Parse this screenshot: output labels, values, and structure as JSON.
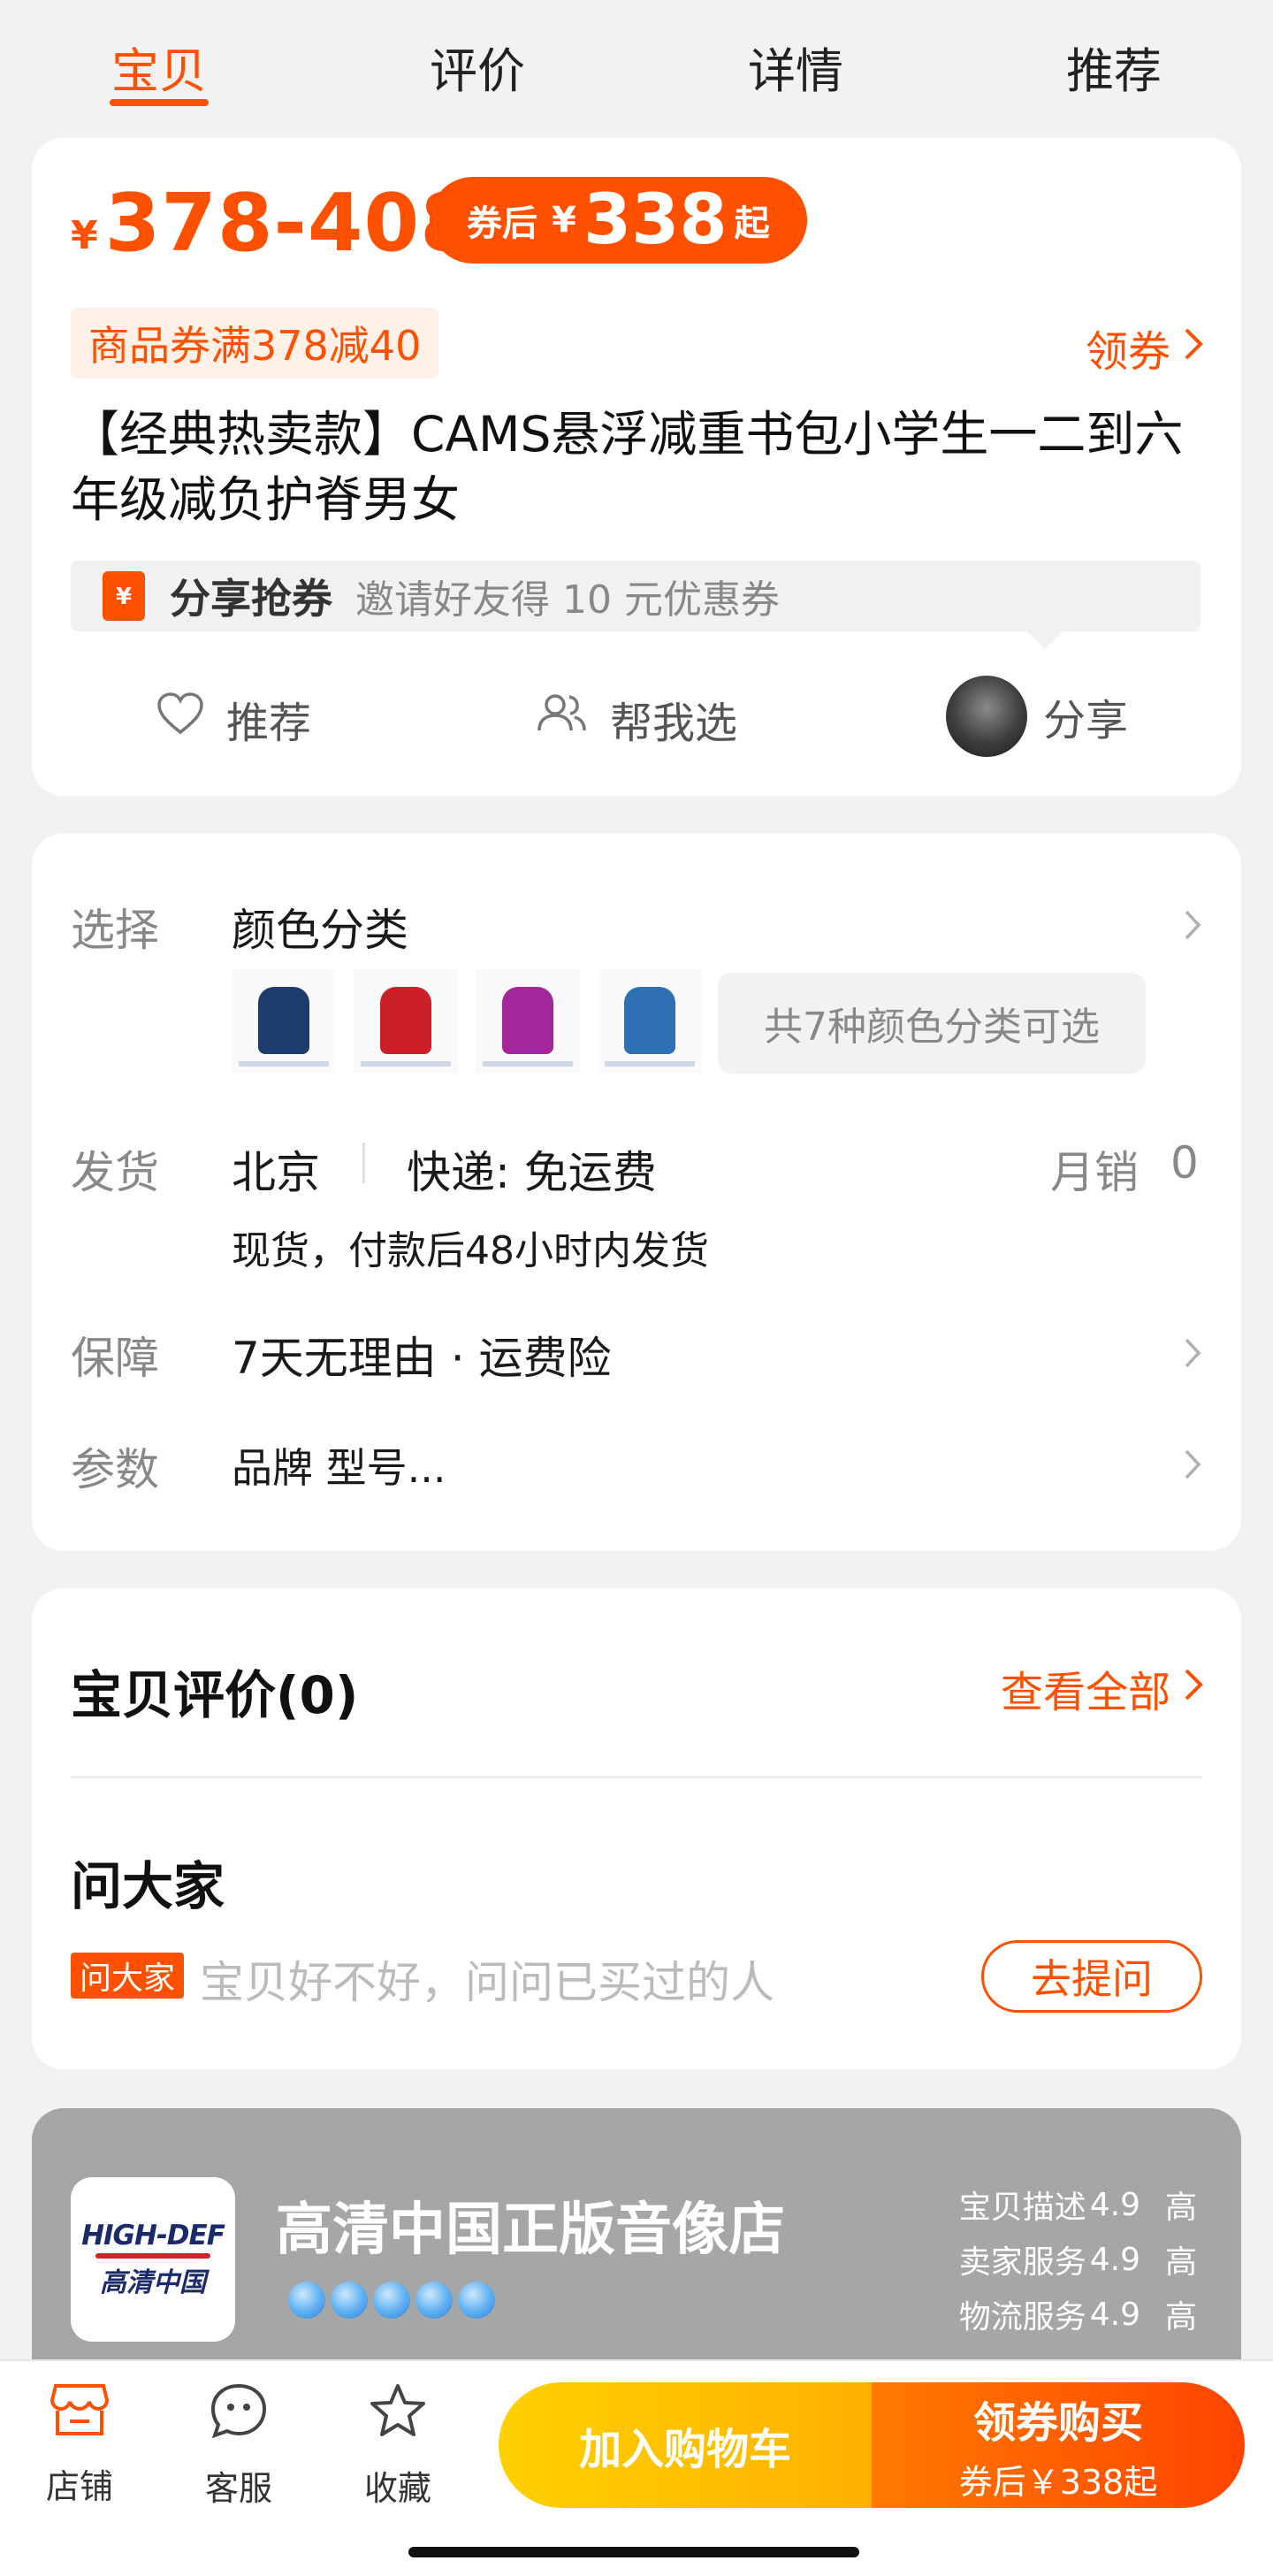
{
  "tabs": [
    "宝贝",
    "评价",
    "详情",
    "推荐"
  ],
  "price": {
    "yen": "¥",
    "range": "378-408",
    "after_coupon_label": "券后",
    "after_coupon_yen": "¥",
    "after_coupon_value": "338",
    "after_coupon_suffix": "起"
  },
  "coupon": {
    "tag": "商品券满378减40",
    "get_label": "领券"
  },
  "product_title": "【经典热卖款】CAMS悬浮减重书包小学生一二到六年级减负护脊男女",
  "share_bar": {
    "title": "分享抢券",
    "desc": "邀请好友得 10 元优惠券"
  },
  "actions": {
    "recommend": "推荐",
    "help_choose": "帮我选",
    "share": "分享"
  },
  "spec": {
    "select_label": "选择",
    "select_value": "颜色分类",
    "color_count_text": "共7种颜色分类可选",
    "thumb_colors": [
      "#1d3b6b",
      "#cc1f2a",
      "#a3279a",
      "#2f6fb3"
    ],
    "ship_label": "发货",
    "ship_city": "北京",
    "ship_method": "快递: 免运费",
    "monthly_sales_label": "月销",
    "monthly_sales_value": "0",
    "ship_note": "现货，付款后48小时内发货",
    "guarantee_label": "保障",
    "guarantee_value": "7天无理由 · 运费险",
    "params_label": "参数",
    "params_value": "品牌 型号..."
  },
  "reviews": {
    "title": "宝贝评价(0)",
    "view_all": "查看全部"
  },
  "ask": {
    "title": "问大家",
    "tag": "问大家",
    "placeholder": "宝贝好不好，问问已买过的人",
    "button": "去提问"
  },
  "shop": {
    "logo_en": "HIGH-DEF",
    "logo_cn": "高清中国",
    "name": "高清中国正版音像店",
    "ratings": [
      {
        "label": "宝贝描述",
        "score": "4.9",
        "level": "高"
      },
      {
        "label": "卖家服务",
        "score": "4.9",
        "level": "高"
      },
      {
        "label": "物流服务",
        "score": "4.9",
        "level": "高"
      }
    ]
  },
  "bottom": {
    "store": "店铺",
    "service": "客服",
    "favorite": "收藏",
    "add_cart": "加入购物车",
    "buy": "领券购买",
    "buy_sub": "券后￥338起"
  },
  "colors": {
    "accent": "#ff5000",
    "cart_button": "#ffc000",
    "shop_bg": "#a6a6a6"
  }
}
